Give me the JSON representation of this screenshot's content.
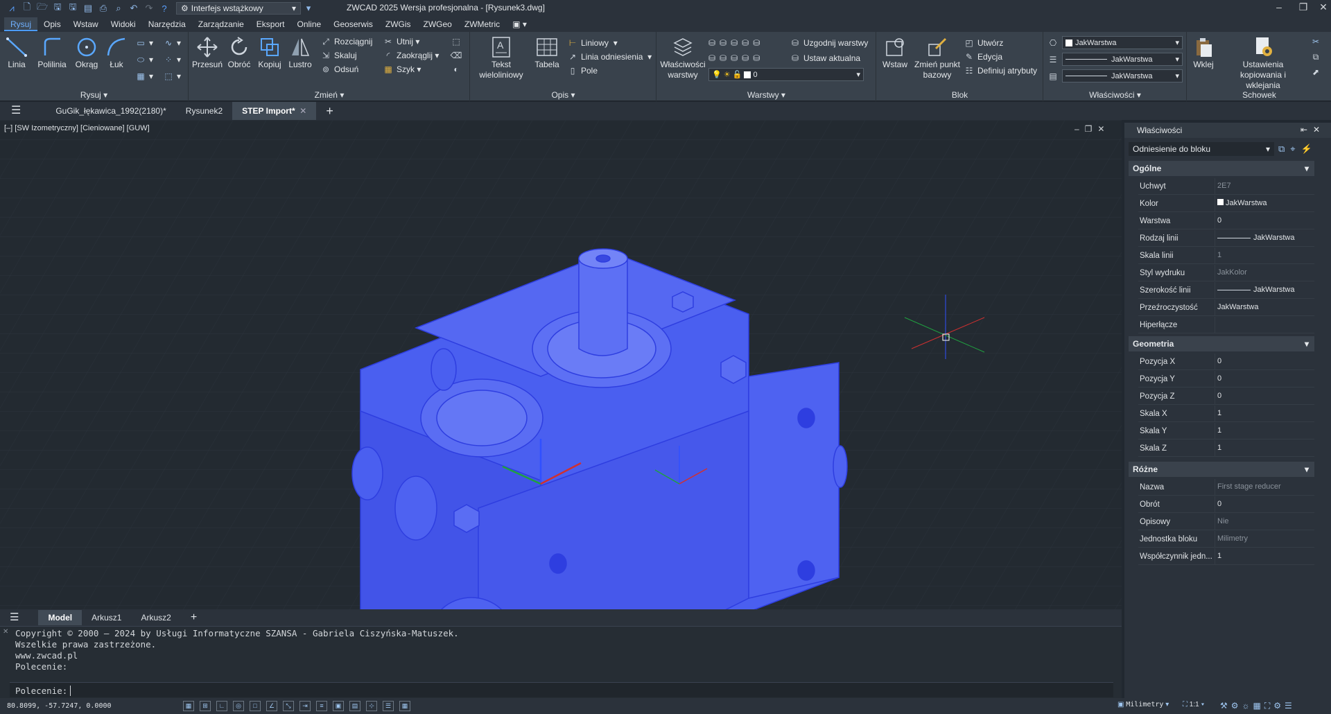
{
  "title_bar": {
    "interface_dropdown": "Interfejs wstążkowy",
    "app_title": "ZWCAD 2025 Wersja profesjonalna - [Rysunek3.dwg]"
  },
  "menu": [
    "Rysuj",
    "Opis",
    "Wstaw",
    "Widoki",
    "Narzędzia",
    "Zarządzanie",
    "Eksport",
    "Online",
    "Geoserwis",
    "ZWGis",
    "ZWGeo",
    "ZWMetric"
  ],
  "ribbon": {
    "rysuj": {
      "label": "Rysuj",
      "linia": "Linia",
      "polilinia": "Polilinia",
      "okrag": "Okrąg",
      "luk": "Łuk"
    },
    "zmien": {
      "label": "Zmień",
      "przesun": "Przesuń",
      "obroc": "Obróć",
      "kopiuj": "Kopiuj",
      "lustro": "Lustro",
      "rozciagnij": "Rozciągnij",
      "skaluj": "Skaluj",
      "odsun": "Odsuń",
      "utnij": "Utnij",
      "zaokraglij": "Zaokrąglij",
      "szyk": "Szyk"
    },
    "opis": {
      "label": "Opis",
      "tekst": "Tekst wieloliniowy",
      "tabela": "Tabela",
      "liniowy": "Liniowy",
      "linia_odniesienia": "Linia odniesienia",
      "pole": "Pole"
    },
    "warstwy": {
      "label": "Warstwy",
      "wlasciwosci": "Właściwości warstwy",
      "uzgodnij": "Uzgodnij warstwy",
      "ustaw": "Ustaw aktualna",
      "current_layer": "0"
    },
    "blok": {
      "label": "Blok",
      "wstaw": "Wstaw",
      "zmien_punkt": "Zmień punkt bazowy",
      "utworz": "Utwórz",
      "edycja": "Edycja",
      "definiuj": "Definiuj atrybuty"
    },
    "wlasciwosci": {
      "label": "Właściwości",
      "color": "JakWarstwa",
      "linetype": "JakWarstwa",
      "lineweight": "JakWarstwa"
    },
    "schowek": {
      "label": "Schowek",
      "wklej": "Wklej",
      "ustawienia": "Ustawienia kopiowania i wklejania"
    }
  },
  "doc_tabs": [
    "GuGik_łękawica_1992(2180)*",
    "Rysunek2",
    "STEP Import*"
  ],
  "viewport_label": "[–] [SW Izometryczny] [Cieniowane] [GUW]",
  "layout_tabs": [
    "Model",
    "Arkusz1",
    "Arkusz2"
  ],
  "command_history": [
    "Copyright © 2000 – 2024 by Usługi Informatyczne SZANSA - Gabriela Ciszyńska-Matuszek.",
    "Wszelkie prawa zastrzeżone.",
    "www.zwcad.pl",
    "Polecenie:"
  ],
  "command_prompt": "Polecenie:",
  "status": {
    "coords": "80.8099, -57.7247, 0.0000",
    "units": "Milimetry",
    "scale": "1:1"
  },
  "properties": {
    "title": "Właściwości",
    "selection": "Odniesienie do bloku",
    "sections": {
      "ogolne": "Ogólne",
      "geometria": "Geometria",
      "rozne": "Różne"
    },
    "ogolne": [
      [
        "Uchwyt",
        "2E7"
      ],
      [
        "Kolor",
        "JakWarstwa"
      ],
      [
        "Warstwa",
        "0"
      ],
      [
        "Rodzaj linii",
        "JakWarstwa"
      ],
      [
        "Skala linii",
        "1"
      ],
      [
        "Styl wydruku",
        "JakKolor"
      ],
      [
        "Szerokość linii",
        "JakWarstwa"
      ],
      [
        "Przeźroczystość",
        "JakWarstwa"
      ],
      [
        "Hiperłącze",
        ""
      ]
    ],
    "geometria": [
      [
        "Pozycja X",
        "0"
      ],
      [
        "Pozycja Y",
        "0"
      ],
      [
        "Pozycja Z",
        "0"
      ],
      [
        "Skala X",
        "1"
      ],
      [
        "Skala Y",
        "1"
      ],
      [
        "Skala Z",
        "1"
      ]
    ],
    "rozne": [
      [
        "Nazwa",
        "First stage reducer"
      ],
      [
        "Obrót",
        "0"
      ],
      [
        "Opisowy",
        "Nie"
      ],
      [
        "Jednostka bloku",
        "Milimetry"
      ],
      [
        "Współczynnik jedn...",
        "1"
      ]
    ]
  },
  "colors": {
    "model_blue": "#4a5ff0",
    "accent": "#4c9bff"
  }
}
